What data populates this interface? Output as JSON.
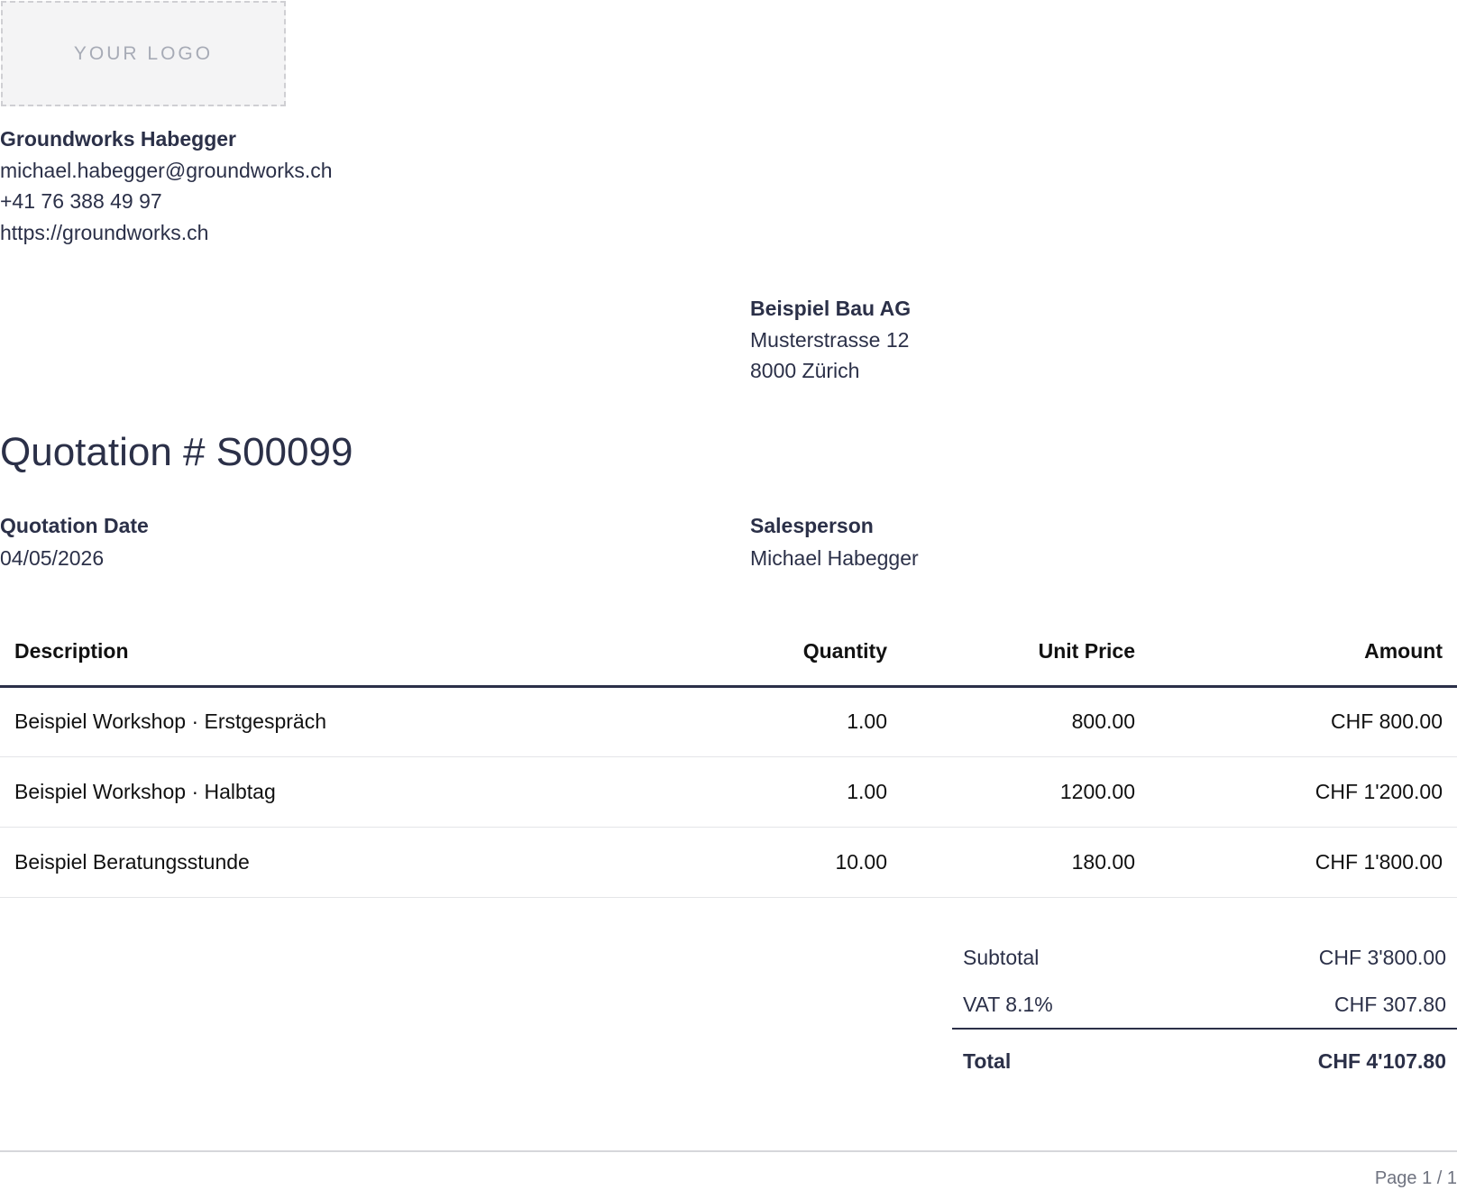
{
  "logo": {
    "text": "YOUR LOGO"
  },
  "company": {
    "name": "Groundworks Habegger",
    "email": "michael.habegger@groundworks.ch",
    "phone": "+41 76 388 49 97",
    "website": "https://groundworks.ch"
  },
  "customer": {
    "name": "Beispiel Bau AG",
    "street": "Musterstrasse 12",
    "city": "8000 Zürich"
  },
  "title": "Quotation # S00099",
  "meta": {
    "date_label": "Quotation Date",
    "date_value": "04/05/2026",
    "salesperson_label": "Salesperson",
    "salesperson_value": "Michael Habegger"
  },
  "table": {
    "headers": {
      "description": "Description",
      "quantity": "Quantity",
      "unit_price": "Unit Price",
      "amount": "Amount"
    },
    "rows": [
      {
        "description": "Beispiel Workshop · Erstgespräch",
        "quantity": "1.00",
        "unit_price": "800.00",
        "amount": "CHF 800.00"
      },
      {
        "description": "Beispiel Workshop · Halbtag",
        "quantity": "1.00",
        "unit_price": "1200.00",
        "amount": "CHF 1'200.00"
      },
      {
        "description": "Beispiel Beratungsstunde",
        "quantity": "10.00",
        "unit_price": "180.00",
        "amount": "CHF 1'800.00"
      }
    ]
  },
  "totals": {
    "subtotal_label": "Subtotal",
    "subtotal_value": "CHF 3'800.00",
    "vat_label": "VAT 8.1%",
    "vat_value": "CHF 307.80",
    "total_label": "Total",
    "total_value": "CHF 4'107.80"
  },
  "footer": {
    "page": "Page 1 / 1"
  },
  "colors": {
    "text": "#2b3048",
    "table_text": "#111111",
    "rule": "#2b3048",
    "row_divider": "#e4e5e8",
    "logo_bg": "#f4f4f5",
    "muted": "#6f7380"
  }
}
